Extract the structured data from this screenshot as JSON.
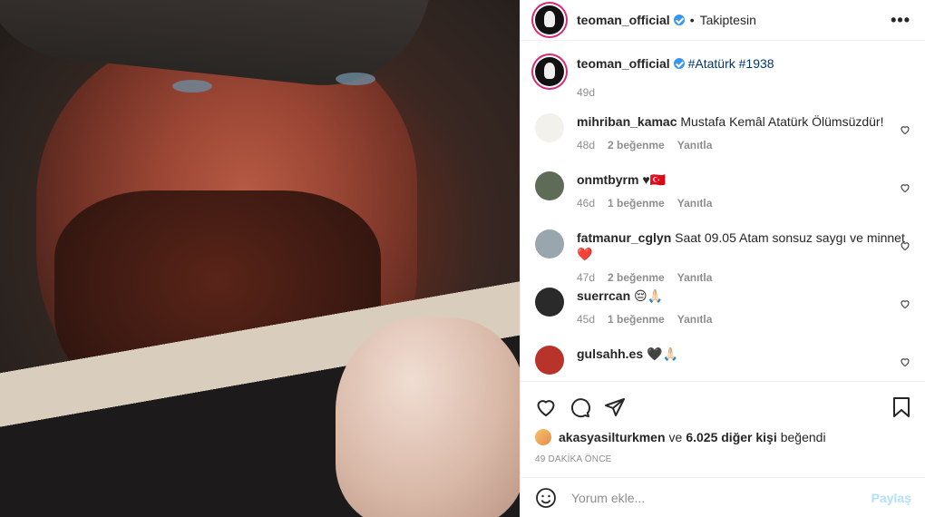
{
  "header": {
    "username": "teoman_official",
    "separator": "•",
    "follow_status": "Takiptesin",
    "more_icon": "more-horizontal-icon"
  },
  "caption": {
    "username": "teoman_official",
    "hashtags": "#Atatürk #1938",
    "time": "49d"
  },
  "comments": [
    {
      "username": "mihriban_kamac",
      "text": "Mustafa Kemâl Atatürk Ölümsüzdür!",
      "time": "48d",
      "likes": "2 beğenme",
      "reply": "Yanıtla"
    },
    {
      "username": "onmtbyrm",
      "text": "♥🇹🇷",
      "time": "46d",
      "likes": "1 beğenme",
      "reply": "Yanıtla"
    },
    {
      "username": "fatmanur_cglyn",
      "text": "Saat 09.05 Atam sonsuz saygı ve minnet ❤️",
      "time": "47d",
      "likes": "2 beğenme",
      "reply": "Yanıtla"
    },
    {
      "username": "suerrcan",
      "text": "😔🙏🏻",
      "time": "45d",
      "likes": "1 beğenme",
      "reply": "Yanıtla"
    },
    {
      "username": "gulsahh.es",
      "text": "🖤🙏🏻",
      "time": "",
      "likes": "",
      "reply": ""
    }
  ],
  "likes": {
    "liker": "akasyasilturkmen",
    "connector": "ve",
    "others": "6.025 diğer kişi",
    "suffix": "beğendi"
  },
  "time_ago": "49 DAKİKA ÖNCE",
  "add_comment": {
    "placeholder": "Yorum ekle...",
    "post_label": "Paylaş"
  },
  "colors": {
    "link_blue": "#00376b",
    "verified_blue": "#3897f0",
    "post_disabled": "#b2dffc",
    "muted": "#8e8e8e",
    "text": "#262626"
  }
}
